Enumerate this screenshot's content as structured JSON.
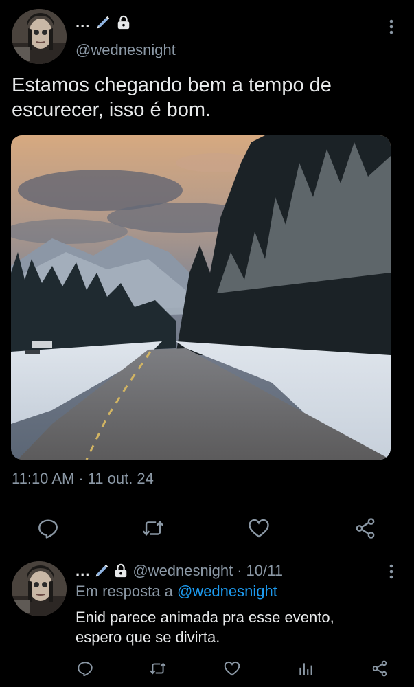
{
  "tweet": {
    "display_name": "...",
    "handle": "@wednesnight",
    "text": "Estamos chegando bem a tempo de escurecer, isso é bom.",
    "time": "11:10 AM",
    "separator": "·",
    "date": "11 out. 24",
    "media_alt": "snowy road through pine forest at dusk"
  },
  "reply": {
    "display_name": "...",
    "handle": "@wednesnight",
    "separator": "·",
    "date": "10/11",
    "in_reply_prefix": "Em resposta a",
    "in_reply_mention": "@wednesnight",
    "text": "Enid parece animada pra esse evento, espero que se divirta."
  },
  "icons": {
    "pen": "pen-icon",
    "lock": "lock-icon",
    "more": "more-vertical-icon",
    "reply": "reply-icon",
    "retweet": "retweet-icon",
    "like": "like-icon",
    "share": "share-icon",
    "analytics": "analytics-icon"
  },
  "colors": {
    "background": "#000000",
    "text": "#e7e9ea",
    "secondary": "#8b98a5",
    "link": "#1d9bf0",
    "divider": "#2f3336"
  }
}
